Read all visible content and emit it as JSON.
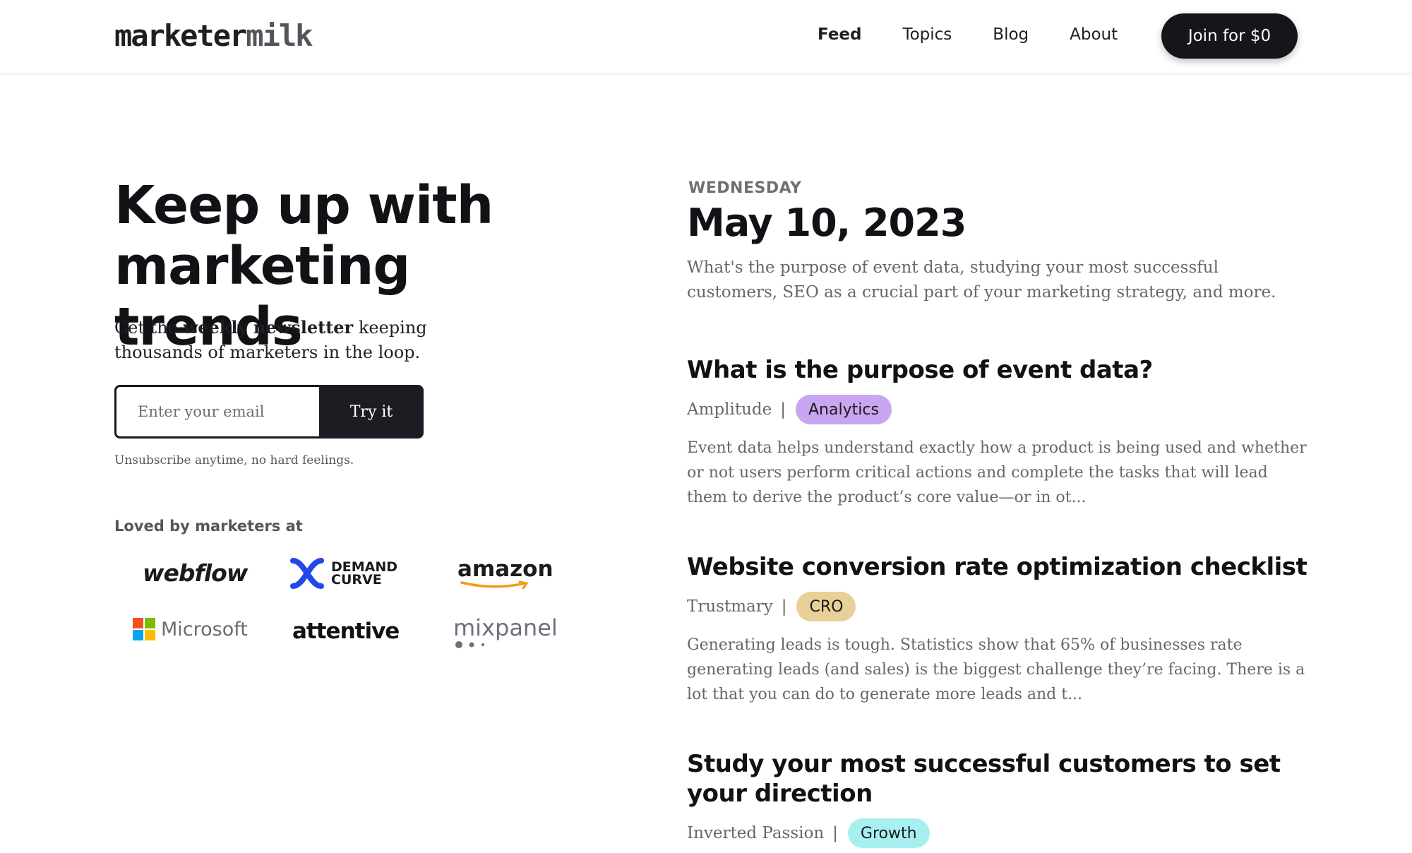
{
  "header": {
    "logo_part1": "marketer",
    "logo_part2": "milk",
    "nav": [
      {
        "label": "Feed",
        "active": true
      },
      {
        "label": "Topics",
        "active": false
      },
      {
        "label": "Blog",
        "active": false
      },
      {
        "label": "About",
        "active": false
      }
    ],
    "cta_label": "Join for $0"
  },
  "hero": {
    "title_line1": "Keep up with",
    "title_line2": "marketing trends",
    "subtitle_pre": "Get the ",
    "subtitle_bold": "weekly newsletter",
    "subtitle_post": " keeping thousands of marketers in the loop.",
    "email_placeholder": "Enter your email",
    "submit_label": "Try it",
    "unsubscribe_note": "Unsubscribe anytime, no hard feelings.",
    "loved_by": "Loved by marketers at"
  },
  "brands": {
    "webflow": "webflow",
    "demand_curve_line1": "DEMAND",
    "demand_curve_line2": "CURVE",
    "amazon": "amazon",
    "microsoft": "Microsoft",
    "attentive": "attentive",
    "mixpanel": "mixpanel"
  },
  "feed": {
    "day": "WEDNESDAY",
    "date": "May 10, 2023",
    "summary": "What's the purpose of event data, studying your most successful customers, SEO as a crucial part of your marketing strategy, and more.",
    "articles": [
      {
        "title": "What is the purpose of event data?",
        "source": "Amplitude",
        "tag": "Analytics",
        "tag_color": "#c8a6f0",
        "excerpt": "Event data helps understand exactly how a product is being used and whether or not users perform critical actions and complete the tasks that will lead them to derive the product’s core value—or in ot..."
      },
      {
        "title": "Website conversion rate optimization checklist",
        "source": "Trustmary",
        "tag": "CRO",
        "tag_color": "#e8d096",
        "excerpt": "Generating leads is tough. Statistics show that 65% of businesses rate generating leads (and sales) is the biggest challenge they’re facing. There is a lot that you can do to generate more leads and t..."
      },
      {
        "title": "Study your most successful customers to set your direction",
        "source": "Inverted Passion",
        "tag": "Growth",
        "tag_color": "#a8f0f0",
        "excerpt": ""
      }
    ]
  },
  "colors": {
    "primary_dark": "#15161c",
    "muted_text": "#66666c"
  }
}
